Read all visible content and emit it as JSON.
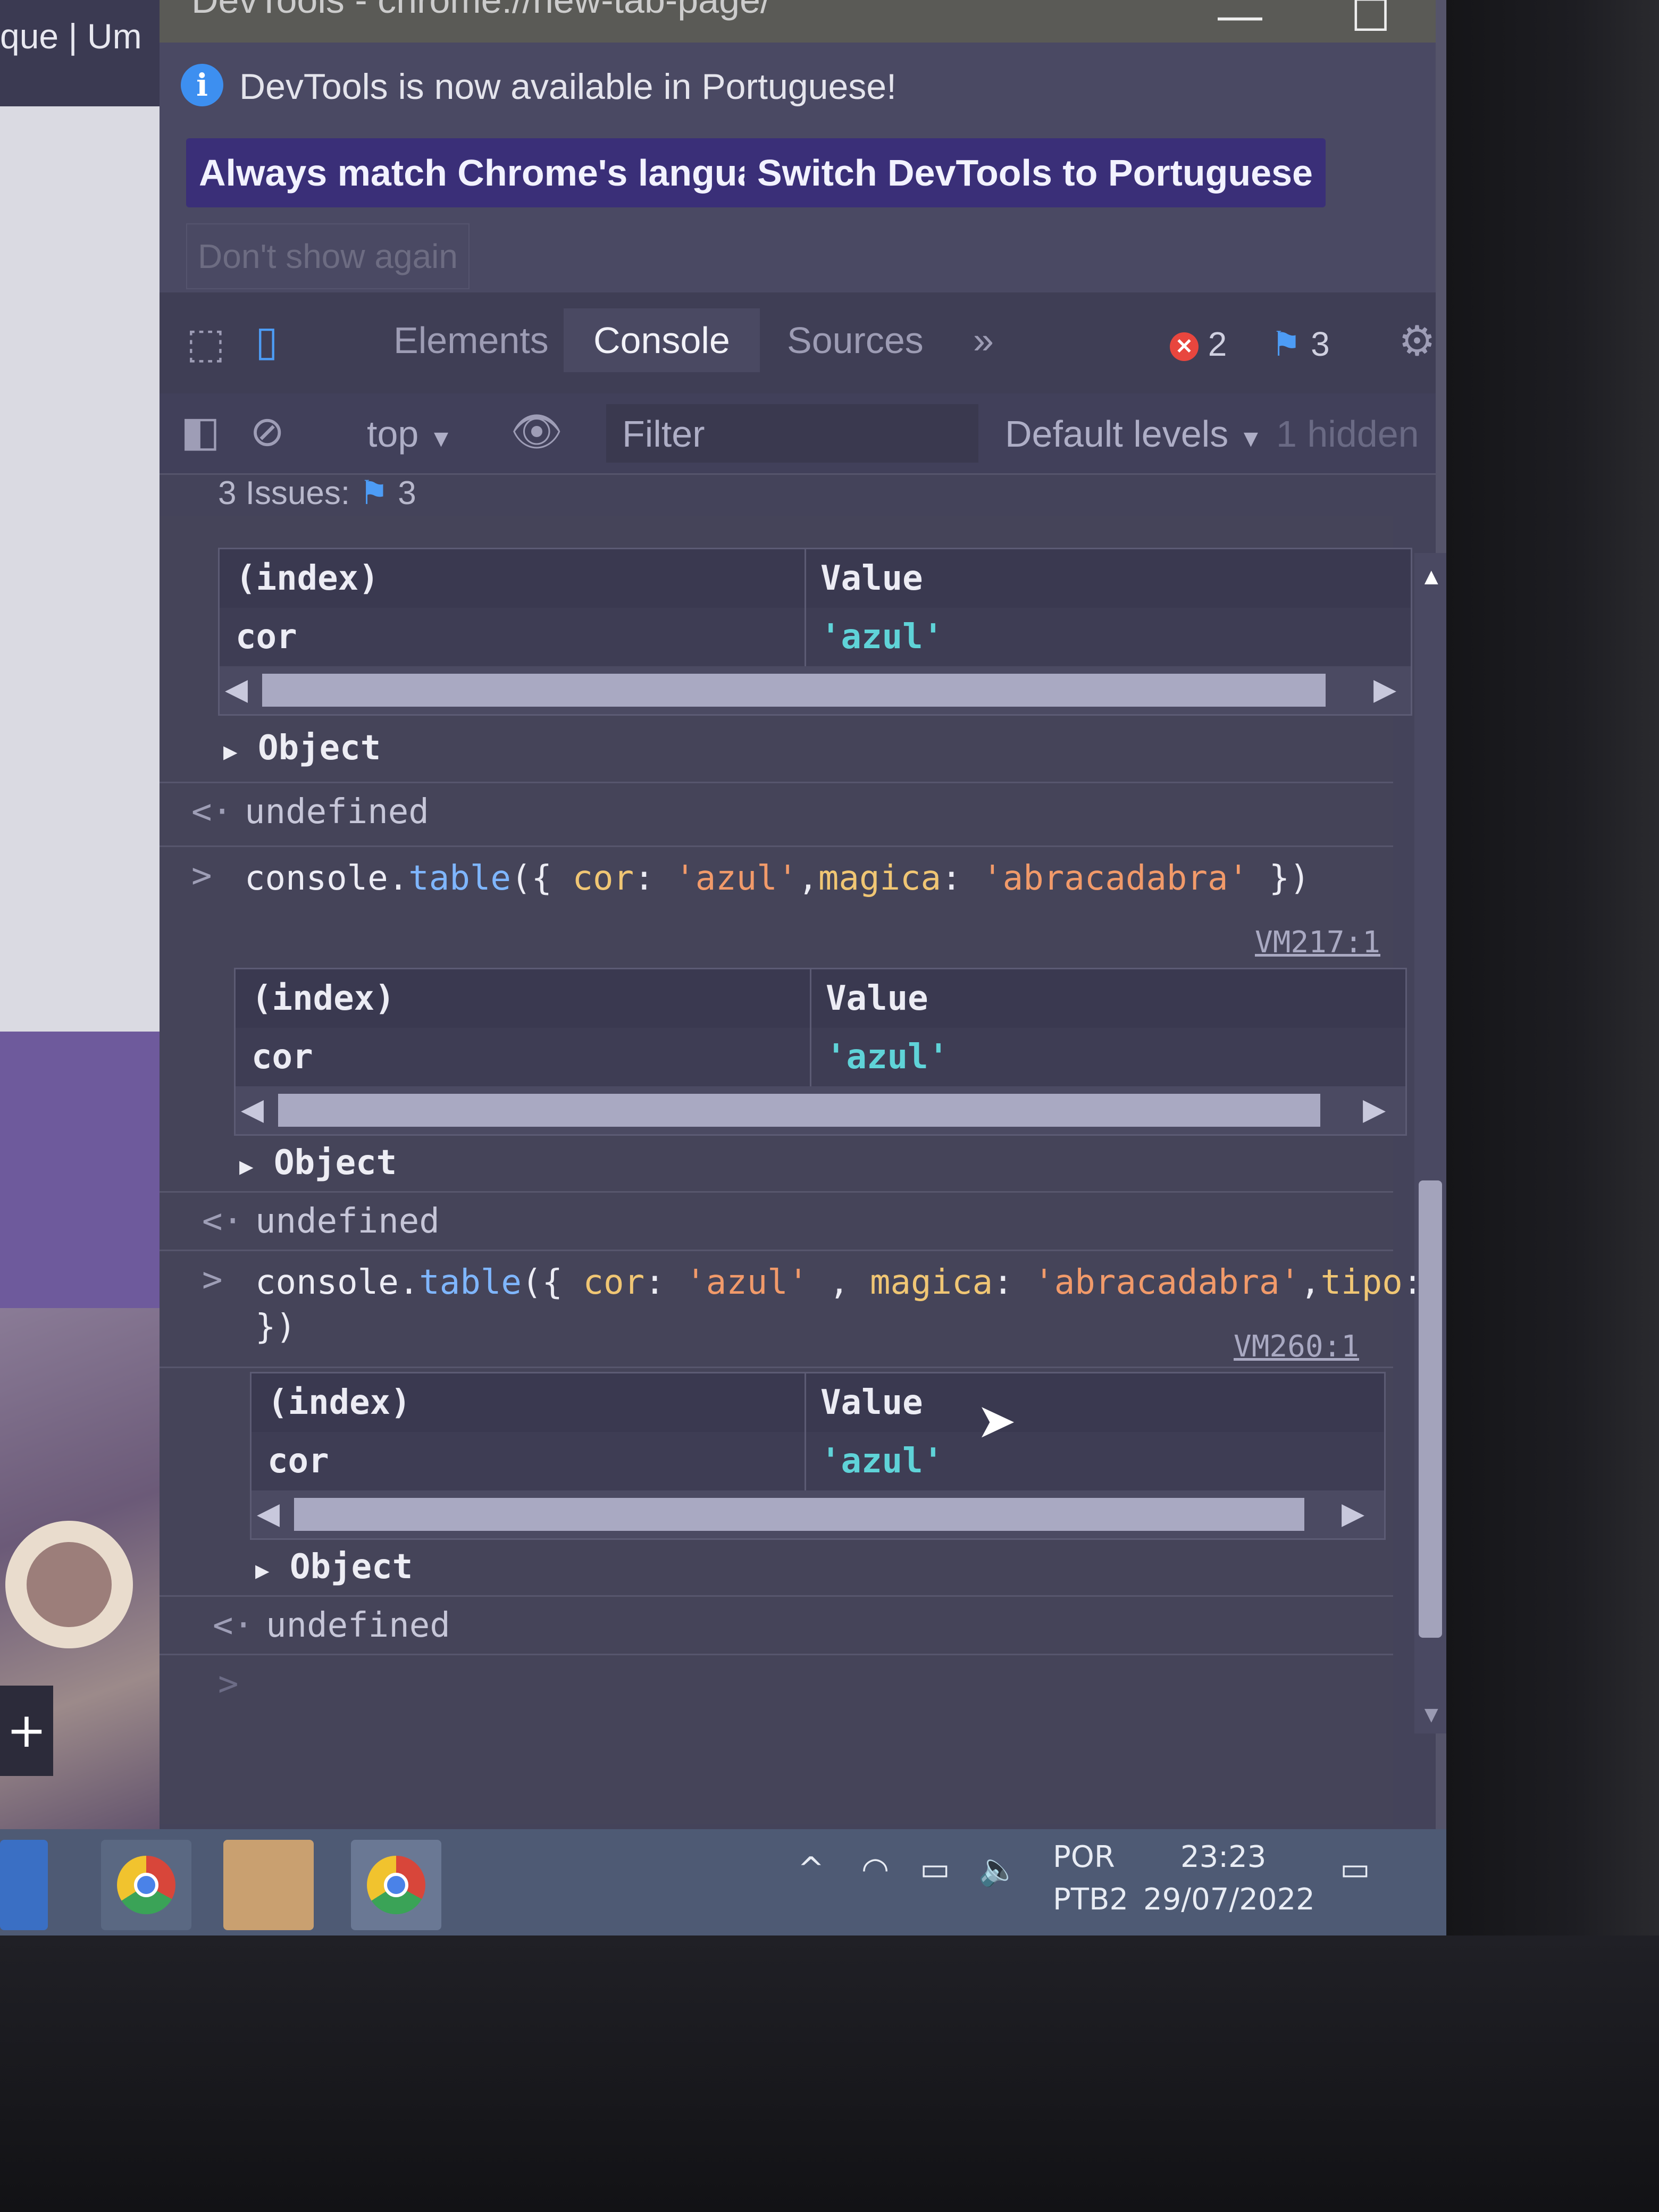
{
  "background_tab": {
    "title": "que | Um"
  },
  "window": {
    "title": "DevTools - chrome://new-tab-page/",
    "minimize_glyph": "—",
    "maximize_glyph": "☐",
    "close_glyph": "✕"
  },
  "infobar": {
    "message": "DevTools is now available in Portuguese!",
    "button_match": "Always match Chrome's language",
    "button_switch": "Switch DevTools to Portuguese",
    "button_dont_show": "Don't show again",
    "close_glyph": "✕"
  },
  "tabs": {
    "items": [
      "Elements",
      "Console",
      "Sources"
    ],
    "active": "Console",
    "more_glyph": "»",
    "error_count": "2",
    "issue_count": "3"
  },
  "toolbar": {
    "context": "top",
    "filter_placeholder": "Filter",
    "levels": "Default levels",
    "hidden": "1 hidden"
  },
  "issues_bar": {
    "label": "3 Issues:",
    "count": "3"
  },
  "console": {
    "entries": [
      {
        "table": {
          "header_index": "(index)",
          "header_value": "Value",
          "row_key": "cor",
          "row_value": "'azul'"
        },
        "object_label": "Object",
        "return": "undefined"
      },
      {
        "command": "console.table({ cor: 'azul',magica: 'abracadabra' })",
        "source": "VM217:1",
        "table": {
          "header_index": "(index)",
          "header_value": "Value",
          "row_key": "cor",
          "row_value": "'azul'"
        },
        "object_label": "Object",
        "return": "undefined"
      },
      {
        "command": "console.table({ cor: 'azul' , magica: 'abracadabra',tipo: table\n})",
        "source": "VM260:1",
        "table": {
          "header_index": "(index)",
          "header_value": "Value",
          "row_key": "cor",
          "row_value": "'azul'"
        },
        "object_label": "Object",
        "return": "undefined"
      }
    ],
    "prompt_glyph": ">",
    "return_glyph": "<·"
  },
  "taskbar": {
    "language_top": "POR",
    "language_bottom": "PTB2",
    "time": "23:23",
    "date": "29/07/2022"
  },
  "colors": {
    "accent_button": "#3a2f78",
    "string_value": "#5fd3d8",
    "error_badge": "#e8463e",
    "info_icon": "#3d8ff0"
  }
}
